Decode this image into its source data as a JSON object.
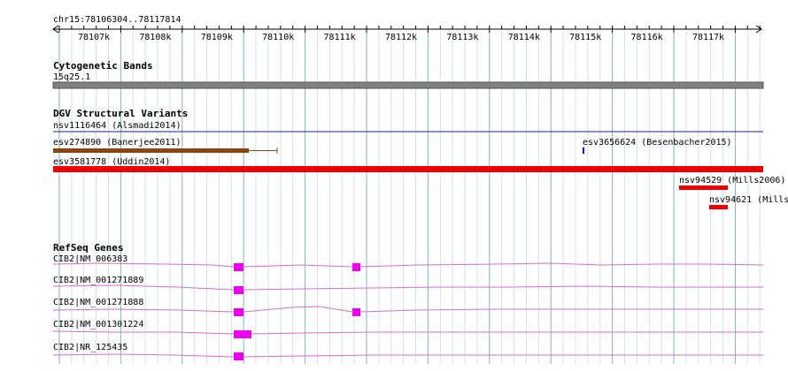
{
  "location": "chr15:78106304..78117814",
  "ruler": {
    "ticks": [
      "78107k",
      "78108k",
      "78109k",
      "78110k",
      "78111k",
      "78112k",
      "78113k",
      "78114k",
      "78115k",
      "78116k",
      "78117k"
    ]
  },
  "tracks": {
    "cytoband": {
      "title": "Cytogenetic Bands",
      "band_label": "15q25.1",
      "band_color": "#808080"
    },
    "dgv": {
      "title": "DGV Structural Variants",
      "features": [
        {
          "label": "nsv1116464 (Alsmadi2014)",
          "color": "#1a237e"
        },
        {
          "label": "esv274890 (Banerjee2011)",
          "color": "#8b4513"
        },
        {
          "label": "esv3656624 (Besenbacher2015)",
          "color": "#0000cc"
        },
        {
          "label": "esv3581778 (Uddin2014)",
          "color": "#ee0000"
        },
        {
          "label": "nsv94529 (Mills2006)",
          "color": "#ee0000"
        },
        {
          "label": "nsv94621 (Mills",
          "color": "#ee0000"
        }
      ]
    },
    "refseq": {
      "title": "RefSeq Genes",
      "transcript_color": "#d070d0",
      "exon_color": "#ee00ee",
      "transcripts": [
        "CIB2|NM_006383",
        "CIB2|NM_001271889",
        "CIB2|NM_001271888",
        "CIB2|NM_001301224",
        "CIB2|NR_125435"
      ]
    }
  }
}
